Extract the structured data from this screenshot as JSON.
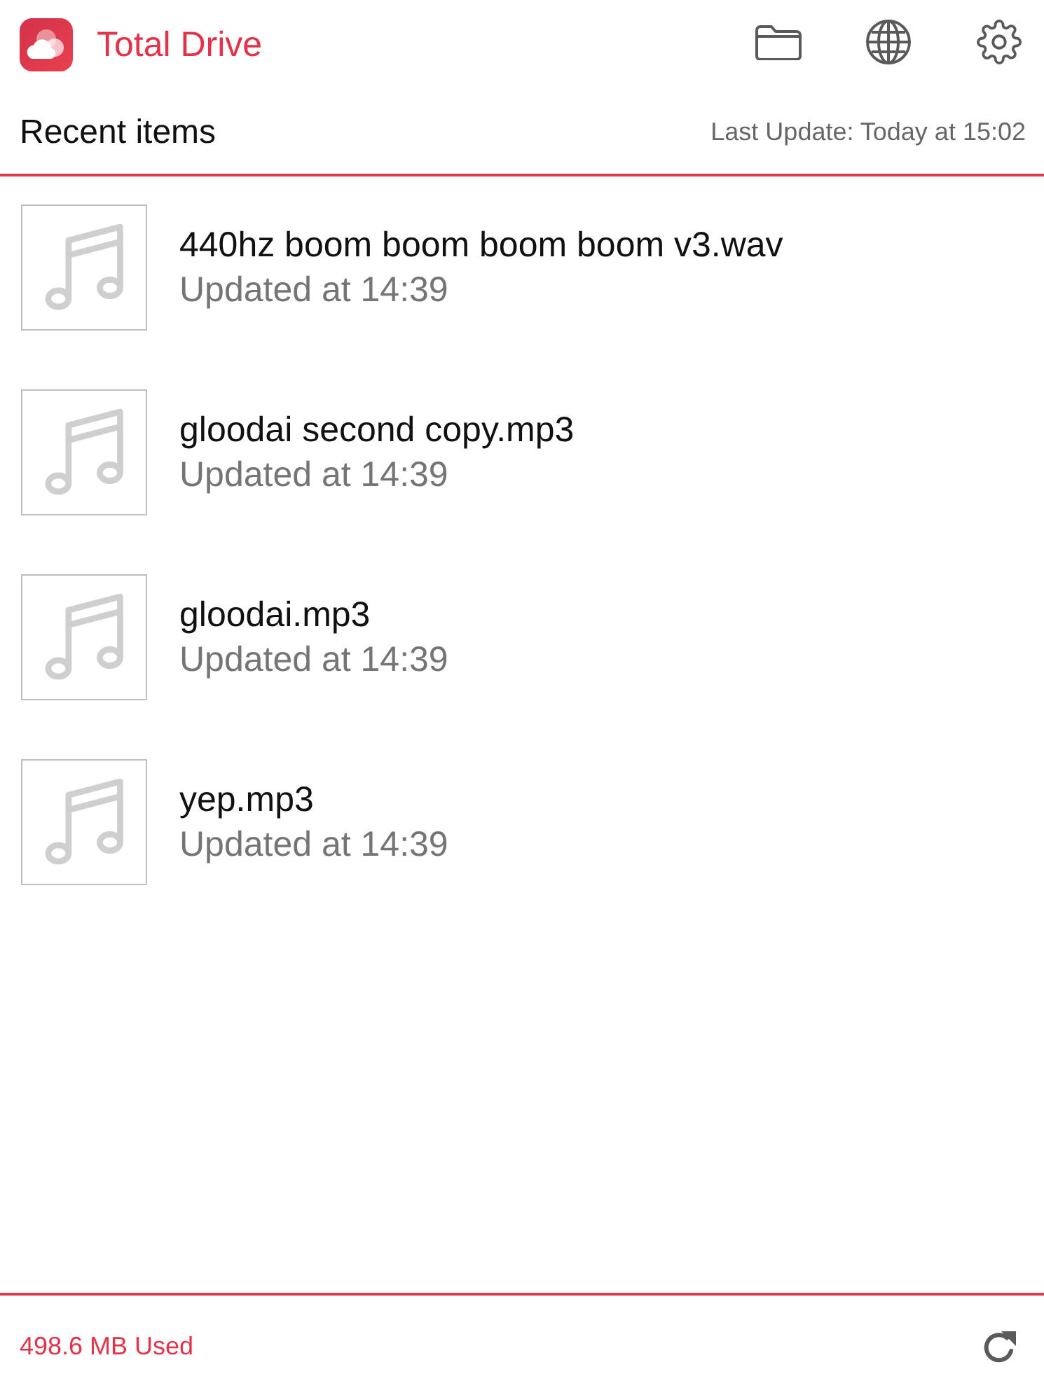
{
  "app": {
    "title": "Total Drive"
  },
  "section": {
    "title": "Recent items",
    "last_update": "Last Update: Today at 15:02"
  },
  "items": [
    {
      "name": "440hz boom boom boom boom v3.wav",
      "updated": "Updated at 14:39"
    },
    {
      "name": "gloodai second copy.mp3",
      "updated": "Updated at 14:39"
    },
    {
      "name": "gloodai.mp3",
      "updated": "Updated at 14:39"
    },
    {
      "name": "yep.mp3",
      "updated": "Updated at 14:39"
    }
  ],
  "footer": {
    "usage": "498.6 MB Used"
  }
}
